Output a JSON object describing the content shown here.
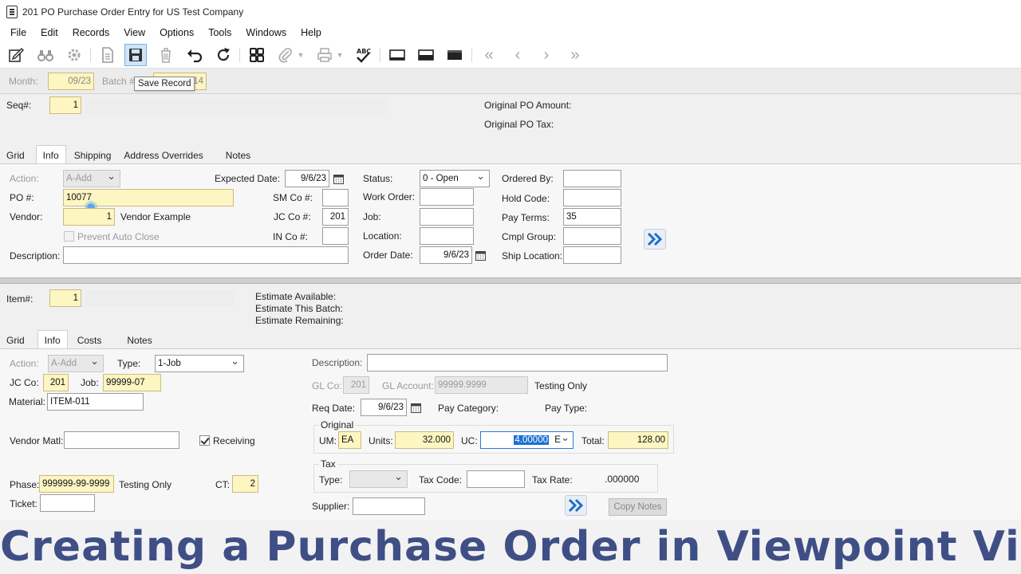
{
  "window": {
    "title": "201 PO Purchase Order Entry for US Test Company"
  },
  "menu": [
    "File",
    "Edit",
    "Records",
    "View",
    "Options",
    "Tools",
    "Windows",
    "Help"
  ],
  "toolbar": {
    "tooltip": "Save Record"
  },
  "header": {
    "month_label": "Month:",
    "month_value": "09/23",
    "batch_label": "Batch #",
    "batch_value": "14"
  },
  "po_header": {
    "seq_label": "Seq#:",
    "seq_value": "1",
    "orig_amount_label": "Original PO Amount:",
    "orig_tax_label": "Original PO Tax:"
  },
  "tabs_top": [
    "Grid",
    "Info",
    "Shipping",
    "Address Overrides",
    "Notes"
  ],
  "po_info": {
    "action_label": "Action:",
    "action_value": "A-Add",
    "po_label": "PO #:",
    "po_value": "10077",
    "vendor_label": "Vendor:",
    "vendor_value": "1",
    "vendor_name": "Vendor Example",
    "prevent_label": "Prevent Auto Close",
    "description_label": "Description:",
    "description_value": "",
    "expected_label": "Expected Date:",
    "expected_value": "9/6/23",
    "sm_label": "SM Co #:",
    "sm_value": "",
    "jc_label": "JC Co #:",
    "jc_value": "201",
    "in_label": "IN Co #:",
    "in_value": "",
    "status_label": "Status:",
    "status_value": "0 - Open",
    "work_order_label": "Work Order:",
    "work_order_value": "",
    "job_label": "Job:",
    "job_value": "",
    "location_label": "Location:",
    "location_value": "",
    "order_date_label": "Order Date:",
    "order_date_value": "9/6/23",
    "ordered_by_label": "Ordered By:",
    "ordered_by_value": "",
    "hold_code_label": "Hold Code:",
    "hold_code_value": "",
    "pay_terms_label": "Pay Terms:",
    "pay_terms_value": "35",
    "cmpl_group_label": "Cmpl Group:",
    "cmpl_group_value": "",
    "ship_location_label": "Ship Location:",
    "ship_location_value": ""
  },
  "item_header": {
    "item_label": "Item#:",
    "item_value": "1",
    "est_available": "Estimate Available:",
    "est_batch": "Estimate This Batch:",
    "est_remaining": "Estimate Remaining:"
  },
  "tabs_bottom": [
    "Grid",
    "Info",
    "Costs",
    "Notes"
  ],
  "item_info": {
    "action_label": "Action:",
    "action_value": "A-Add",
    "type_label": "Type:",
    "type_value": "1-Job",
    "jcco_label": "JC Co:",
    "jcco_value": "201",
    "job_label": "Job:",
    "job_value": "99999-07",
    "material_label": "Material:",
    "material_value": "ITEM-011",
    "vendor_matl_label": "Vendor Matl:",
    "vendor_matl_value": "",
    "receiving_label": "Receiving",
    "phase_label": "Phase:",
    "phase_value": "999999-99-9999",
    "phase_desc": "Testing Only",
    "ct_label": "CT:",
    "ct_value": "2",
    "ticket_label": "Ticket:",
    "ticket_value": "",
    "description_label": "Description:",
    "description_value": "",
    "glco_label": "GL Co:",
    "glco_value": "201",
    "glacct_label": "GL Account:",
    "glacct_value": "99999.9999",
    "glacct_desc": "Testing Only",
    "req_date_label": "Req Date:",
    "req_date_value": "9/6/23",
    "pay_category_label": "Pay Category:",
    "pay_type_label": "Pay Type:",
    "original_label": "Original",
    "um_label": "UM:",
    "um_value": "EA",
    "units_label": "Units:",
    "units_value": "32.000",
    "uc_label": "UC:",
    "uc_value": "4.00000",
    "uc_unit": "E",
    "total_label": "Total:",
    "total_value": "128.00",
    "tax_label": "Tax",
    "tax_type_label": "Type:",
    "tax_type_value": "",
    "tax_code_label": "Tax Code:",
    "tax_code_value": "",
    "tax_rate_label": "Tax Rate:",
    "tax_rate_value": ".000000",
    "supplier_label": "Supplier:",
    "supplier_value": "",
    "copy_notes": "Copy Notes"
  },
  "caption": "Creating a Purchase Order in Viewpoint Vista",
  "colors": {
    "required_field": "#fdf5c2",
    "caption_text": "#3f4f86",
    "selection": "#1c6fd1",
    "active_tool": "#cfe4f7"
  }
}
